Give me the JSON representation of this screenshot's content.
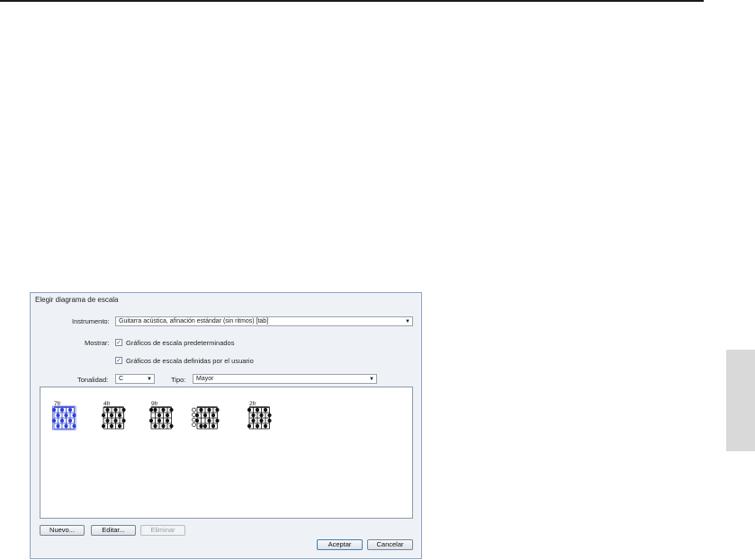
{
  "dialog": {
    "title": "Elegir diagrama de escala",
    "instrument_label": "Instrumento:",
    "instrument_value": "Guitarra acústica, afinación estándar (sin ritmos) [tab]",
    "show_label": "Mostrar:",
    "show_default_label": "Gráficos de escala predeterminados",
    "show_default_checked": true,
    "show_user_label": "Gráficos de escala definidas por el usuario",
    "show_user_checked": true,
    "key_label": "Tonalidad:",
    "key_value": "C",
    "type_label": "Tipo:",
    "type_value": "Mayor",
    "diagrams": [
      {
        "fret": "7fr",
        "selected": true
      },
      {
        "fret": "4fr",
        "selected": false
      },
      {
        "fret": "9fr",
        "selected": false
      },
      {
        "fret": "",
        "selected": false
      },
      {
        "fret": "2fr",
        "selected": false
      }
    ],
    "buttons": {
      "new": "Nuevo...",
      "edit": "Editar...",
      "delete": "Eliminar",
      "ok": "Aceptar",
      "cancel": "Cancelar"
    }
  },
  "colors": {
    "selected": "#2b3fd6",
    "normal": "#111111",
    "frame": "#8da5c3"
  },
  "icons": {
    "dropdown": "triangle-down-icon",
    "check": "checkmark-icon"
  }
}
